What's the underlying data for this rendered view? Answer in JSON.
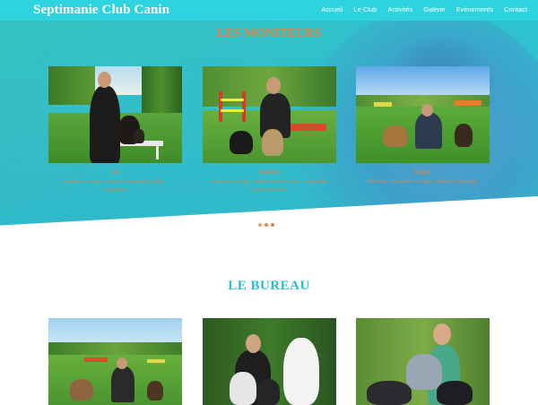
{
  "site": {
    "brand": "Septimanie Club Canin"
  },
  "nav": {
    "items": [
      "Accueil",
      "Le Club",
      "Activités",
      "Galerie",
      "Evènements",
      "Contact"
    ]
  },
  "moniteurs": {
    "title": "LES MONITEURS",
    "cards": [
      {
        "name": "Gil",
        "role": "moniteur 1er degré - section et responsable agility - compétition"
      },
      {
        "name": "Sandrine",
        "role": "monitrice 1er degré - diplôme école du chiot - responsable section éducation"
      },
      {
        "name": "Régine",
        "role": "Bénévolat - monitrice 1er degré - diplôme Sophrologie"
      }
    ],
    "carousel_dots": 3
  },
  "bureau": {
    "title": "LE BUREAU"
  },
  "colors": {
    "nav": "#2ed3e0",
    "accent_orange": "#e8843f",
    "teal": "#22c0d0"
  }
}
